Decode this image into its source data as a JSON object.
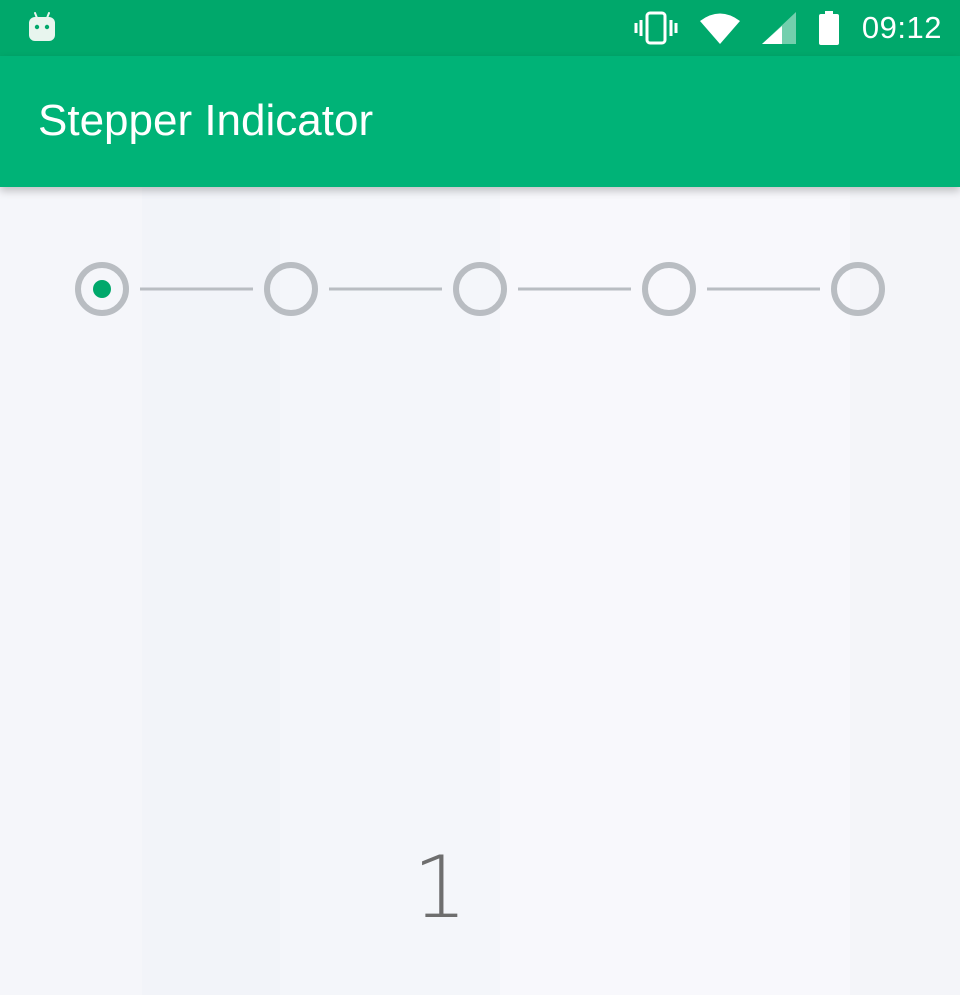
{
  "status_bar": {
    "time": "09:12",
    "icons": [
      "android-debug-icon",
      "vibrate-icon",
      "wifi-icon",
      "cell-signal-icon",
      "battery-icon"
    ]
  },
  "app_bar": {
    "title": "Stepper Indicator"
  },
  "stepper": {
    "step_count": 5,
    "current_step": 1,
    "colors": {
      "active_dot": "#00a86b",
      "circle": "#b9bdc2",
      "line": "#b9bdc2"
    }
  },
  "page": {
    "number": "1"
  },
  "colors": {
    "status_bar": "#00a86b",
    "app_bar": "#00b377",
    "background": "#f7f8fc"
  }
}
